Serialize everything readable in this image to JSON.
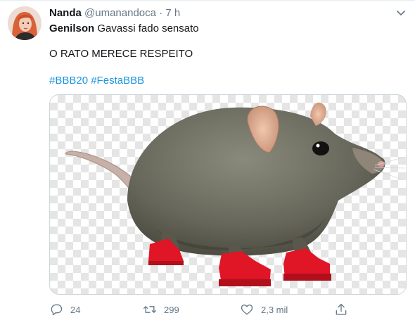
{
  "tweet": {
    "author_name": "Nanda",
    "author_handle": "@umanandoca",
    "separator": "·",
    "time": "7 h",
    "reply_to_name": "Genilson",
    "reply_to_text": "Gavassi fado sensato",
    "text": "O RATO MERECE RESPEITO",
    "hashtags": [
      "#BBB20",
      "#FestaBBB"
    ]
  },
  "actions": {
    "reply_count": "24",
    "retweet_count": "299",
    "like_count": "2,3 mil"
  },
  "icons": {
    "more": "chevron-down-icon",
    "reply": "reply-icon",
    "retweet": "retweet-icon",
    "like": "heart-icon",
    "share": "share-icon"
  },
  "colors": {
    "link": "#1b95e0",
    "secondary_text": "#657786",
    "primary_text": "#14171a",
    "border": "#ccd6dd",
    "shoe_red": "#e01525"
  }
}
